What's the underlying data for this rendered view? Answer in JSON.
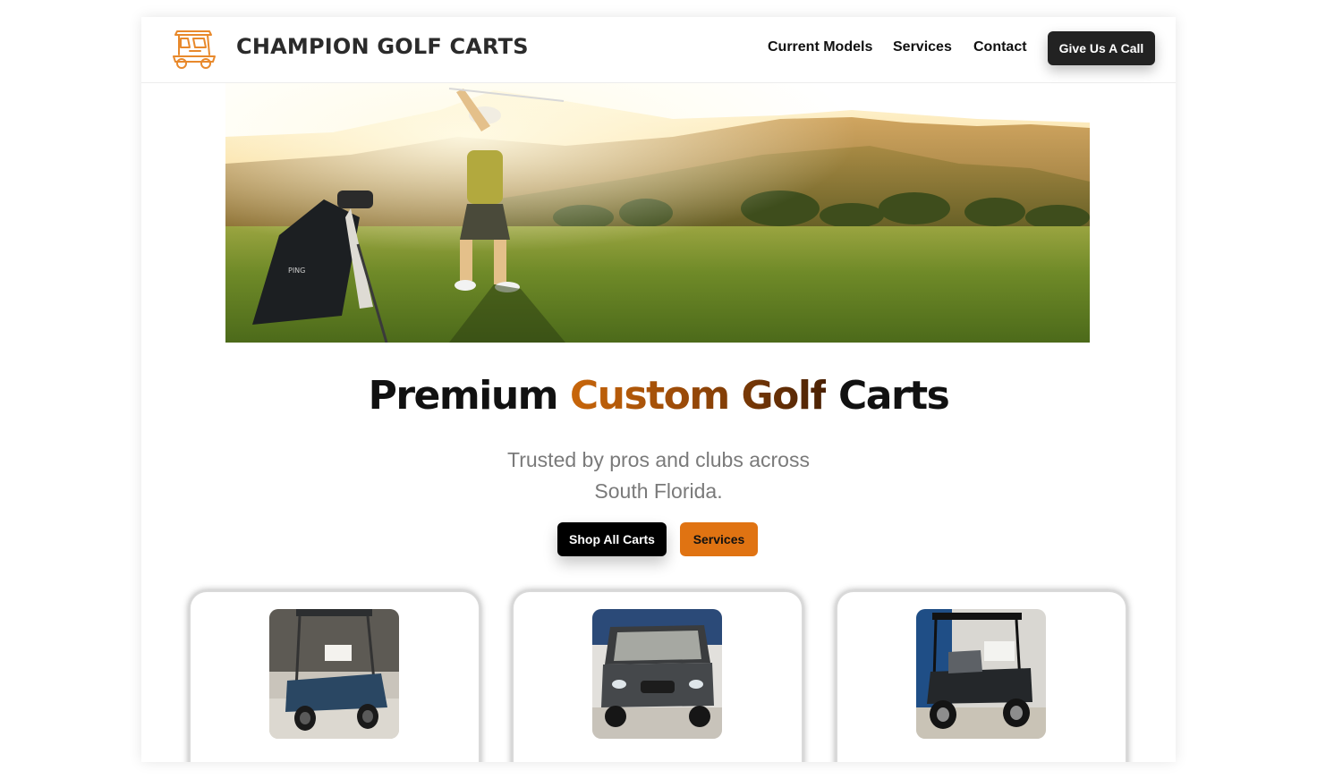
{
  "header": {
    "brand": "CHAMPION GOLF CARTS",
    "nav": [
      {
        "label": "Current Models"
      },
      {
        "label": "Services"
      },
      {
        "label": "Contact"
      }
    ],
    "cta_label": "Give Us A Call",
    "logo_icon": "golf-cart-icon"
  },
  "hero": {
    "image": "golfer-swing-sunset-photo",
    "bag_brand": "PING",
    "headline_plain": "Premium",
    "headline_accent": "Custom Golf",
    "headline_end": "Carts",
    "subtitle": "Trusted by pros and clubs across South Florida.",
    "primary_button": "Shop All Carts",
    "secondary_button": "Services"
  },
  "cards": [
    {
      "image": "blue-golf-cart-photo"
    },
    {
      "image": "gray-enclosed-golf-cart-photo"
    },
    {
      "image": "black-lifted-golf-cart-photo"
    }
  ],
  "colors": {
    "accent": "#e07312",
    "accent_dark": "#4a2104",
    "dark_button": "#222222",
    "text": "#111111",
    "muted": "#7a7a7a"
  }
}
